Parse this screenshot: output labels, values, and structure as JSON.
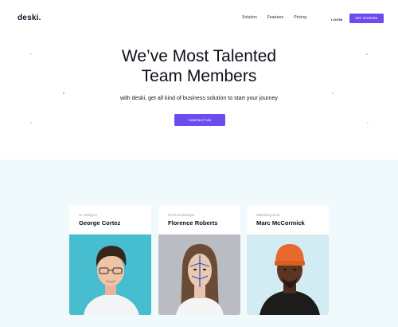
{
  "header": {
    "logo": "deski.",
    "nav": [
      "Solution",
      "Features",
      "Pricing"
    ],
    "login": "LOGIN",
    "cta": "GET STARTED"
  },
  "hero": {
    "title_line1": "We’ve Most Talented",
    "title_line2": "Team Members",
    "subtitle": "with deski, get all kind of business solution to start your journey",
    "button": "CONTACT US"
  },
  "team": [
    {
      "role": "UI Designer",
      "name": "George Cortez",
      "photo": "person-glasses-portrait"
    },
    {
      "role": "Product Manager",
      "name": "Florence Roberts",
      "photo": "person-face-paint-portrait"
    },
    {
      "role": "Marketing Exec.",
      "name": "Marc McCormick",
      "photo": "person-orange-beanie-portrait"
    }
  ],
  "colors": {
    "accent": "#6c4cf1",
    "team_bg": "#f0f9fc",
    "photo1_bg": "#3fb8cc",
    "photo2_bg": "#b9bcc0",
    "photo3_bg": "#d3ecf3"
  }
}
